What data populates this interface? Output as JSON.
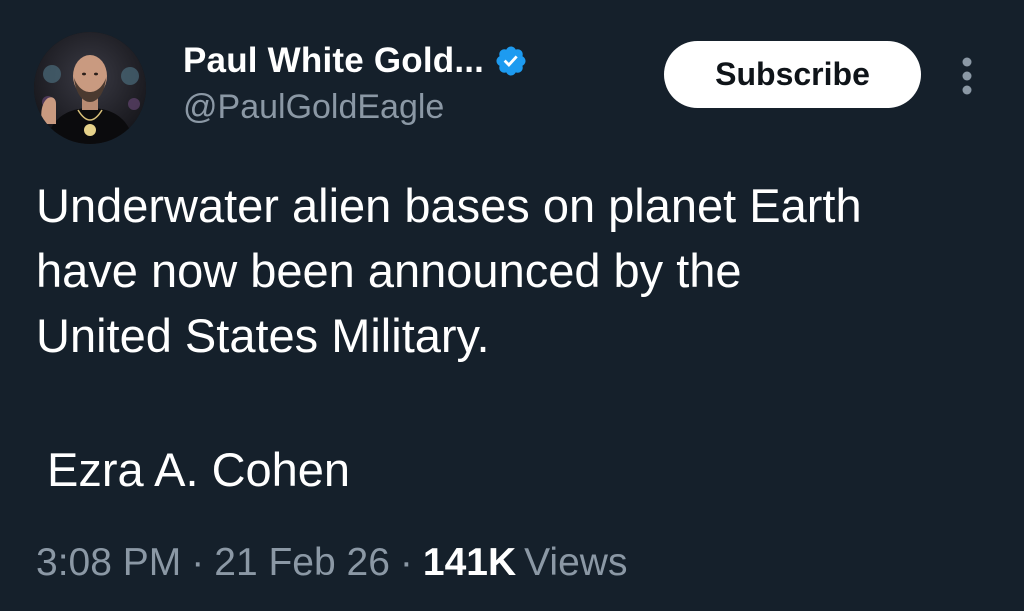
{
  "author": {
    "display_name": "Paul White Gold...",
    "handle": "@PaulGoldEagle",
    "verified_badge_icon": "verified-badge-icon",
    "verified_color": "#1d9bf0"
  },
  "actions": {
    "subscribe_label": "Subscribe",
    "more_icon": "more-vertical-icon"
  },
  "tweet": {
    "text": "Underwater alien bases on planet Earth\nhave now been announced by the\nUnited States Military.",
    "signature": "Ezra A. Cohen"
  },
  "meta": {
    "time": "3:08 PM",
    "separator": "·",
    "date": "21 Feb 26",
    "views_count": "141K",
    "views_label": "Views"
  },
  "colors": {
    "background": "#15202b",
    "text_primary": "#ffffff",
    "text_secondary": "#8b98a5",
    "button_bg": "#ffffff",
    "button_text": "#0f1419"
  }
}
